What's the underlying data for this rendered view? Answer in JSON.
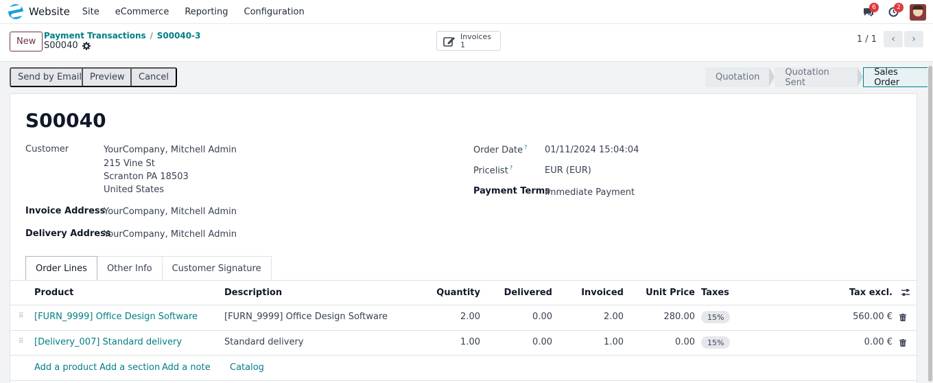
{
  "topbar": {
    "brand": "Website",
    "menu": [
      "Site",
      "eCommerce",
      "Reporting",
      "Configuration"
    ],
    "chat_count": "6",
    "activity_count": "2"
  },
  "control": {
    "new_label": "New",
    "breadcrumb_parent": "Payment Transactions",
    "breadcrumb_child": "S00040-3",
    "record_name": "S00040",
    "smart_button_label": "Invoices",
    "smart_button_count": "1",
    "pager": "1 / 1"
  },
  "actions": {
    "send_email": "Send by Email",
    "preview": "Preview",
    "cancel": "Cancel"
  },
  "stages": [
    "Quotation",
    "Quotation Sent",
    "Sales Order"
  ],
  "form": {
    "title": "S00040",
    "customer_label": "Customer",
    "customer_name": "YourCompany, Mitchell Admin",
    "customer_addr1": "215 Vine St",
    "customer_addr2": "Scranton PA 18503",
    "customer_addr3": "United States",
    "invoice_address_label": "Invoice Address",
    "invoice_address": "YourCompany, Mitchell Admin",
    "delivery_address_label": "Delivery Address",
    "delivery_address": "YourCompany, Mitchell Admin",
    "order_date_label": "Order Date",
    "order_date": "01/11/2024 15:04:04",
    "pricelist_label": "Pricelist",
    "pricelist": "EUR (EUR)",
    "payment_terms_label": "Payment Terms",
    "payment_terms": "Immediate Payment",
    "help_mark": "?"
  },
  "tabs": [
    "Order Lines",
    "Other Info",
    "Customer Signature"
  ],
  "table": {
    "headers": [
      "Product",
      "Description",
      "Quantity",
      "Delivered",
      "Invoiced",
      "Unit Price",
      "Taxes",
      "Tax excl."
    ],
    "rows": [
      {
        "product": "[FURN_9999] Office Design Software",
        "description": "[FURN_9999] Office Design Software",
        "quantity": "2.00",
        "delivered": "0.00",
        "invoiced": "2.00",
        "unit_price": "280.00",
        "tax": "15%",
        "subtotal": "560.00 €"
      },
      {
        "product": "[Delivery_007] Standard delivery",
        "description": "Standard delivery",
        "quantity": "1.00",
        "delivered": "0.00",
        "invoiced": "1.00",
        "unit_price": "0.00",
        "tax": "15%",
        "subtotal": "0.00 €"
      }
    ],
    "add_links": [
      "Add a product",
      "Add a section",
      "Add a note",
      "Catalog"
    ]
  },
  "colors": {
    "accent": "#017e84",
    "brand": "#71324b",
    "badge": "#e0383e"
  },
  "icons": [
    "website-logo-icon",
    "chat-icon",
    "clock-icon",
    "avatar",
    "gear-icon",
    "invoice-edit-icon",
    "chevron-left-icon",
    "chevron-right-icon",
    "drag-handle-icon",
    "trash-icon",
    "column-settings-icon"
  ]
}
